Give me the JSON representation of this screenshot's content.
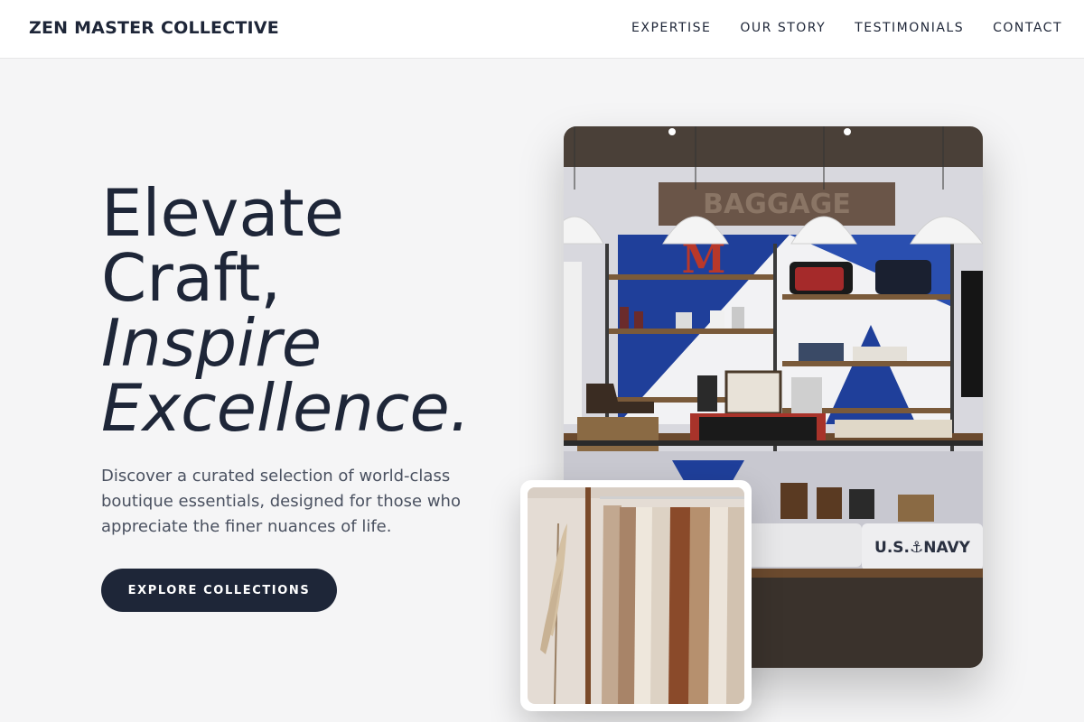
{
  "header": {
    "brand": "ZEN MASTER COLLECTIVE",
    "nav": [
      {
        "label": "EXPERTISE"
      },
      {
        "label": "OUR STORY"
      },
      {
        "label": "TESTIMONIALS"
      },
      {
        "label": "CONTACT"
      }
    ]
  },
  "hero": {
    "title_lines": [
      "Elevate",
      "Craft,",
      "Inspire",
      "Excellence."
    ],
    "description": "Discover a curated selection of world-class boutique essentials, designed for those who appreciate the finer nuances of life.",
    "cta_label": "EXPLORE COLLECTIONS"
  },
  "images": {
    "main_sign": "BAGGAGE",
    "main_letter": "M",
    "main_textile": "U.S.⚓NAVY"
  },
  "colors": {
    "primary": "#1e2638",
    "background": "#f5f5f6",
    "muted_text": "#4a5160"
  }
}
